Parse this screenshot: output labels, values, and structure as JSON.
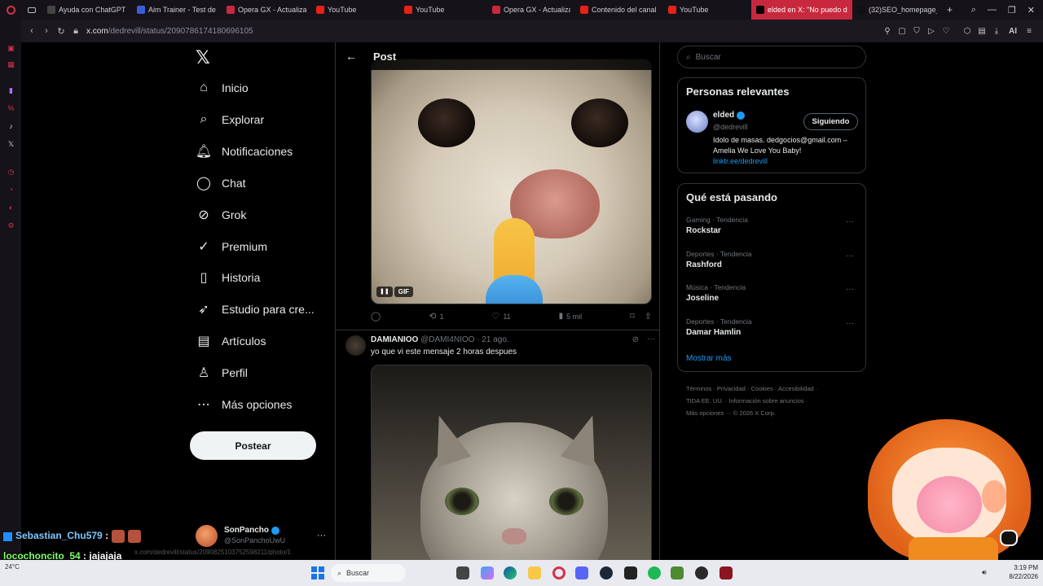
{
  "browser": {
    "tabs": [
      {
        "label": "Ayuda con ChatGPT",
        "color": "#444"
      },
      {
        "label": "Aim Trainer - Test de",
        "color": "#3b5bdb"
      },
      {
        "label": "Opera GX - Actualiza",
        "color": "#c8283d"
      },
      {
        "label": "YouTube",
        "color": "#e62117"
      },
      {
        "label": "YouTube",
        "color": "#e62117"
      },
      {
        "label": "Opera GX - Actualiza",
        "color": "#c8283d"
      },
      {
        "label": "Contenido del canal",
        "color": "#e62117"
      },
      {
        "label": "YouTube",
        "color": "#e62117"
      },
      {
        "label": "elded en X: \"No puedo dor",
        "color": "#000",
        "active": true
      },
      {
        "label": "(32)SEO_homepage_t",
        "color": "#111"
      }
    ],
    "new_tab": "+",
    "url_host": "x.com",
    "url_path": "/dedrevill/status/2090786174180696105",
    "ai_label": "AI"
  },
  "nav": {
    "items": [
      {
        "label": "Inicio",
        "icon": "home-icon"
      },
      {
        "label": "Explorar",
        "icon": "search-icon"
      },
      {
        "label": "Notificaciones",
        "icon": "bell-icon"
      },
      {
        "label": "Chat",
        "icon": "chat-icon"
      },
      {
        "label": "Grok",
        "icon": "grok-icon"
      },
      {
        "label": "Premium",
        "icon": "premium-icon"
      },
      {
        "label": "Historia",
        "icon": "bookmark-icon"
      },
      {
        "label": "Estudio para cre...",
        "icon": "rocket-icon"
      },
      {
        "label": "Artículos",
        "icon": "article-icon"
      },
      {
        "label": "Perfil",
        "icon": "person-icon"
      },
      {
        "label": "Más opciones",
        "icon": "more-icon"
      }
    ],
    "post_button": "Postear",
    "account": {
      "name": "SonPancho",
      "handle": "@SonPanchoUwU"
    }
  },
  "post": {
    "header_title": "Post",
    "gif_badge": "GIF",
    "actions": {
      "retweets": "1",
      "likes": "11",
      "views": "5 mil"
    },
    "reply": {
      "name": "DAMIANIOO",
      "handle": "@DAMI4NIOO",
      "time": "· 21 ago.",
      "text": "yo que vi este mensaje 2 horas despues"
    }
  },
  "right": {
    "search_placeholder": "Buscar",
    "relevant": {
      "title": "Personas relevantes",
      "name": "elded",
      "handle": "@dedrevill",
      "follow_label": "Siguiendo",
      "bio": "Idolo de masas. dedgocios@gmail.com – Amelia We Love You Baby!",
      "link": "linktr.ee/dedrevill"
    },
    "trends": {
      "title": "Qué está pasando",
      "items": [
        {
          "meta": "Gaming · Tendencia",
          "name": "Rockstar"
        },
        {
          "meta": "Deportes · Tendencia",
          "name": "Rashford"
        },
        {
          "meta": "Música · Tendencia",
          "name": "Joseline"
        },
        {
          "meta": "Deportes · Tendencia",
          "name": "Damar Hamlin"
        }
      ],
      "show_more": "Mostrar más"
    },
    "footer": {
      "line1": "Términos · Privacidad · Cookies · Accesibilidad ·",
      "line2": "TIDA EE. UU. · Información sobre anuncios ·",
      "line3": "Más opciones ··· © 2026 X Corp."
    }
  },
  "overlay_chat": [
    {
      "user": "Sebastian_Chu579",
      "text": ":",
      "color": "#7ec8ff"
    },
    {
      "user": "locochoncito_54",
      "text": ": jajajaja",
      "color": "#7dff6a"
    },
    {
      "user": "Sebastian_Chu579",
      "text": ":",
      "color": "#7ec8ff"
    }
  ],
  "taskbar": {
    "temp": "24°C",
    "search": "Buscar",
    "time": "3:19 PM",
    "date": "8/22/2026"
  },
  "status_link": "x.com/dedrevill/status/2090825103752598211/photo/1"
}
